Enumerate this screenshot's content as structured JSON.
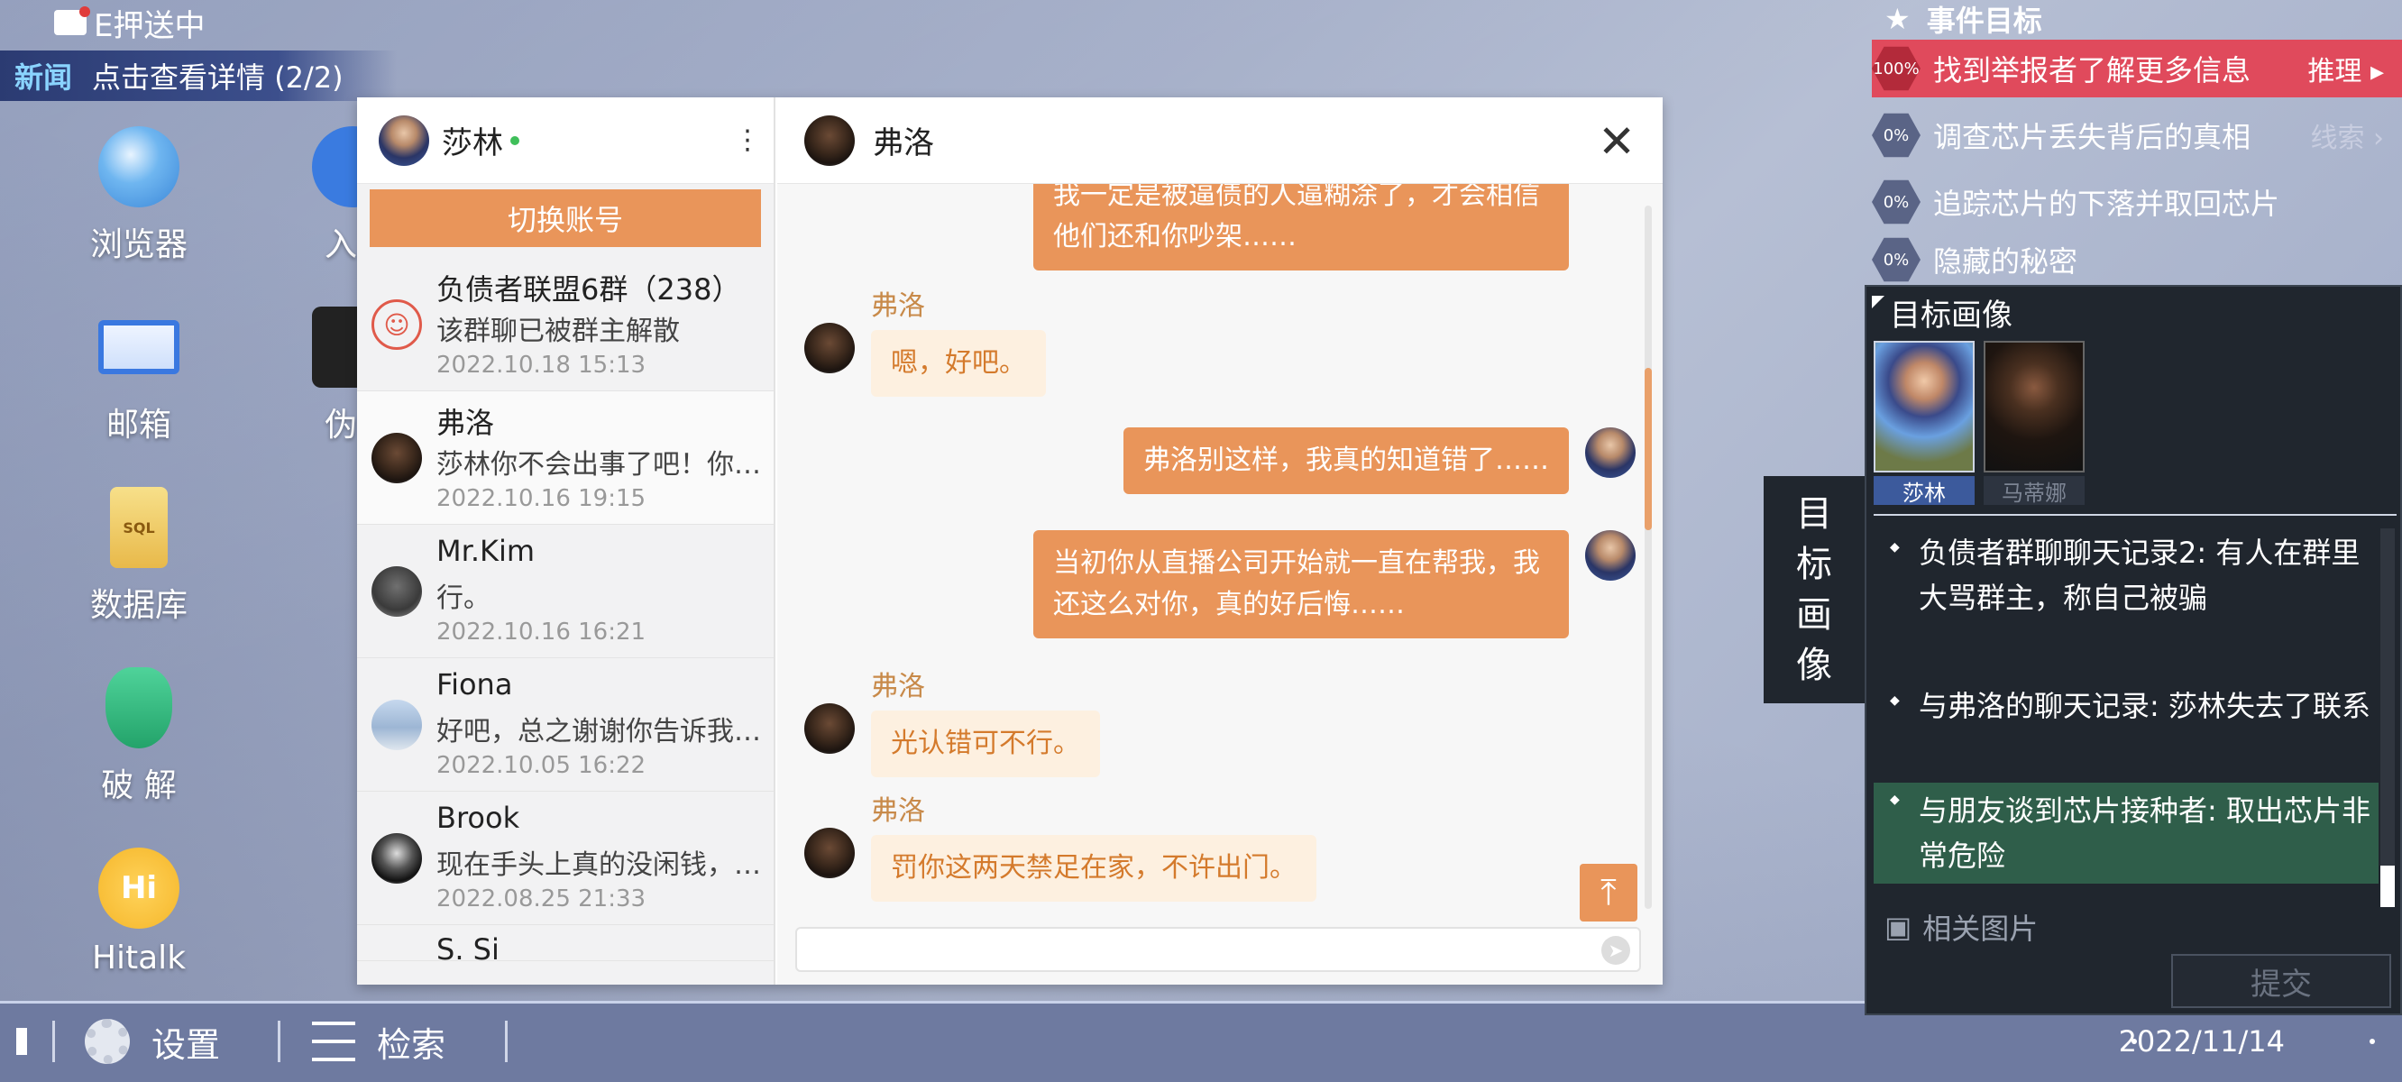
{
  "status": {
    "mail_text": "E押送中"
  },
  "news": {
    "tag": "新闻",
    "text": "点击查看详情 (2/2)"
  },
  "desktop": {
    "icons": [
      {
        "label": "浏览器",
        "icon": "globe-icon"
      },
      {
        "label": "邮箱",
        "icon": "mail-icon"
      },
      {
        "label": "数据库",
        "icon": "sql-database-icon"
      },
      {
        "label": "破 解",
        "icon": "shield-key-icon"
      },
      {
        "label": "Hitalk",
        "icon": "hitalk-icon"
      }
    ],
    "partial_labels": [
      "入",
      "伪"
    ]
  },
  "chat": {
    "account_name": "莎林",
    "switch_account": "切换账号",
    "conversations": [
      {
        "name": "负债者联盟6群（238）",
        "msg": "该群聊已被群主解散",
        "time": "2022.10.18  15:13"
      },
      {
        "name": "弗洛",
        "msg": "莎林你不会出事了吧！你在哪",
        "time": "2022.10.16  19:15"
      },
      {
        "name": "Mr.Kim",
        "msg": "行。",
        "time": "2022.10.16  16:21"
      },
      {
        "name": "Fiona",
        "msg": "好吧，总之谢谢你告诉我这些",
        "time": "2022.10.05  16:22"
      },
      {
        "name": "Brook",
        "msg": "现在手头上真的没闲钱，下个月",
        "time": "2022.08.25  21:33"
      }
    ],
    "partial_next": "S. Si",
    "contact_name": "弗洛",
    "messages": [
      {
        "from": "me",
        "text": "我一定是被逼债的人逼糊涂了，才会相信他们还和你吵架……"
      },
      {
        "from": "them",
        "sender": "弗洛",
        "text": "嗯，好吧。"
      },
      {
        "from": "me",
        "text": "弗洛别这样，我真的知道错了……"
      },
      {
        "from": "me",
        "text": "当初你从直播公司开始就一直在帮我，我还这么对你，真的好后悔……"
      },
      {
        "from": "them",
        "sender": "弗洛",
        "text": "光认错可不行。"
      },
      {
        "from": "them",
        "sender": "弗洛",
        "text": "罚你这两天禁足在家，不许出门。"
      }
    ]
  },
  "events": {
    "title": "事件目标",
    "goals": [
      {
        "progress": "100%",
        "text": "找到举报者了解更多信息",
        "action": "推理"
      },
      {
        "progress": "0%",
        "text": "调查芯片丢失背后的真相",
        "action": "线索"
      },
      {
        "progress": "0%",
        "text": "追踪芯片的下落并取回芯片",
        "action": ""
      },
      {
        "progress": "0%",
        "text": "隐藏的秘密",
        "action": ""
      }
    ]
  },
  "target": {
    "title": "目标画像",
    "side_tab": [
      "目",
      "标",
      "画",
      "像"
    ],
    "portraits": [
      "莎林",
      "马蒂娜"
    ],
    "clues": [
      "负债者群聊聊天记录2: 有人在群里大骂群主，称自己被骗",
      "与弗洛的聊天记录: 莎林失去了联系",
      "与朋友谈到芯片接种者: 取出芯片非常危险"
    ],
    "related": "相关图片",
    "submit": "提交"
  },
  "bottom": {
    "settings": "设置",
    "search": "检索",
    "date": "2022/11/14"
  },
  "colors": {
    "accent": "#e9955a",
    "highlight": "#e04a5c",
    "panel": "#20262e",
    "clue_active": "#2f5e4a"
  }
}
